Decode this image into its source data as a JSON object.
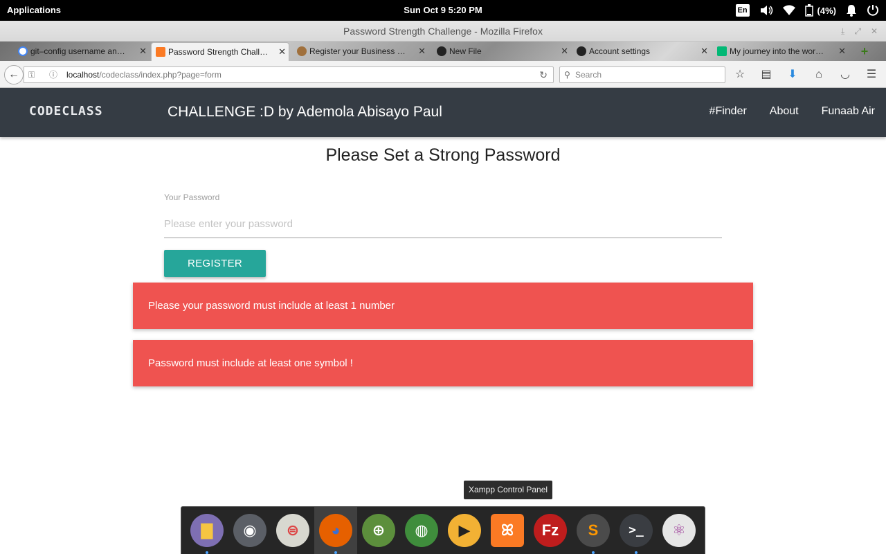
{
  "system": {
    "applications_label": "Applications",
    "clock": "Sun Oct  9  5:20 PM",
    "keyboard_layout": "En",
    "battery": "(4%)"
  },
  "window": {
    "title": "Password Strength Challenge - Mozilla Firefox"
  },
  "tabs": [
    {
      "label": "git–config username an…",
      "icon": "google-icon",
      "active": false
    },
    {
      "label": "Password Strength Chall…",
      "icon": "xampp-icon",
      "active": true
    },
    {
      "label": "Register your Business …",
      "icon": "user-avatar-icon",
      "active": false
    },
    {
      "label": "New File",
      "icon": "github-icon",
      "active": false
    },
    {
      "label": "Account settings",
      "icon": "github-icon",
      "active": false
    },
    {
      "label": "My journey into the wor…",
      "icon": "medium-icon",
      "active": false
    }
  ],
  "address_bar": {
    "host": "localhost",
    "path": "/codeclass/index.php?page=form"
  },
  "search_bar": {
    "placeholder": "Search"
  },
  "app_nav": {
    "brand": "CODECLASS",
    "title": "CHALLENGE :D by Ademola Abisayo Paul",
    "links": [
      "#Finder",
      "About",
      "Funaab Air"
    ]
  },
  "form": {
    "heading": "Please Set a Strong Password",
    "password_label": "Your Password",
    "password_placeholder": "Please enter your password",
    "password_value": "",
    "submit_label": "REGISTER"
  },
  "alerts": [
    "Please your password must include at least 1 number",
    "Password must include at least one symbol !"
  ],
  "tooltip": "Xampp Control Panel",
  "dock": [
    {
      "name": "files-icon",
      "color": "#7e6fb3"
    },
    {
      "name": "screenshot-icon",
      "color": "#5b5f66"
    },
    {
      "name": "settings-toggle-icon",
      "color": "#d8d8d0"
    },
    {
      "name": "firefox-icon",
      "color": "#e66000"
    },
    {
      "name": "globe-network-icon",
      "color": "#5c8f3c"
    },
    {
      "name": "earth-icon",
      "color": "#3f8d3c"
    },
    {
      "name": "media-player-icon",
      "color": "#f2b134"
    },
    {
      "name": "xampp-icon",
      "color": "#fb7a24"
    },
    {
      "name": "filezilla-icon",
      "color": "#bf1d1d"
    },
    {
      "name": "sublime-text-icon",
      "color": "#4b4b4b"
    },
    {
      "name": "terminal-icon",
      "color": "#3a3d42"
    },
    {
      "name": "atom-icon",
      "color": "#e6e6e6"
    }
  ],
  "colors": {
    "app_nav_bg": "#353c44",
    "button_teal": "#26a69a",
    "alert_red": "#ef5350"
  }
}
